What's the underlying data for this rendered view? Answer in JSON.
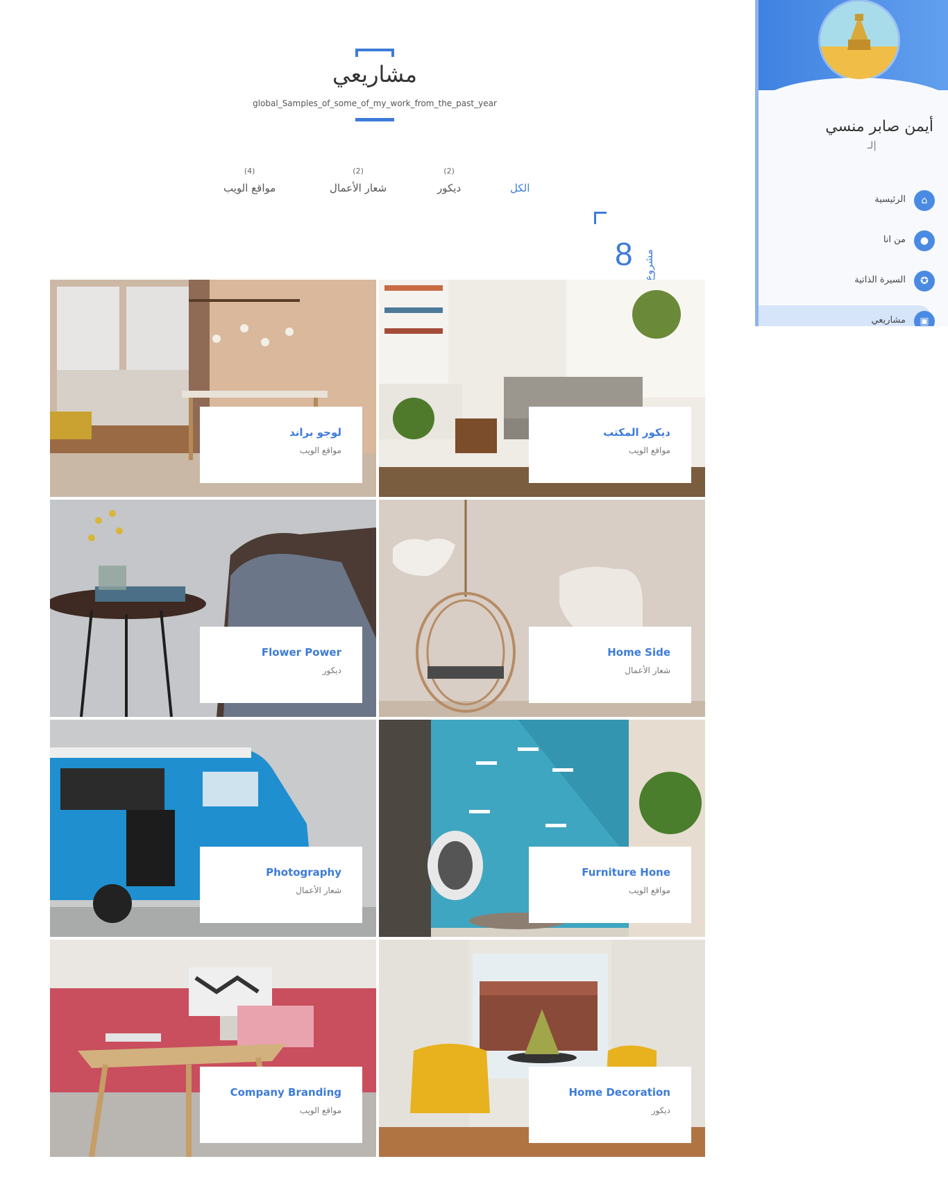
{
  "section": {
    "title": "مشاريعي",
    "subtitle": "global_Samples_of_some_of_my_work_from_the_past_year"
  },
  "filters": [
    {
      "label": "الكل",
      "count": ""
    },
    {
      "label": "ديكور",
      "count": "(2)"
    },
    {
      "label": "شعار الأعمال",
      "count": "(2)"
    },
    {
      "label": "مواقع الويب",
      "count": "(4)"
    }
  ],
  "counter": {
    "number": "8",
    "label": "مشروع"
  },
  "projects": [
    {
      "title": "لوجو براند",
      "category": "مواقع الويب"
    },
    {
      "title": "ديكور المكتب",
      "category": "مواقع الويب"
    },
    {
      "title": "Flower Power",
      "category": "ديكور"
    },
    {
      "title": "Home Side",
      "category": "شعار الأعمال"
    },
    {
      "title": "Photography",
      "category": "شعار الأعمال"
    },
    {
      "title": "Furniture Hone",
      "category": "مواقع الويب"
    },
    {
      "title": "Company Branding",
      "category": "مواقع الويب"
    },
    {
      "title": "Home Decoration",
      "category": "ديكور"
    }
  ],
  "sidebar": {
    "name": "أيمن صابر منسي",
    "typing": "لـ|",
    "nav": [
      {
        "label": "الرئيسية",
        "icon": "home-icon"
      },
      {
        "label": "من انا",
        "icon": "user-icon"
      },
      {
        "label": "السيرة الذاتية",
        "icon": "award-icon"
      },
      {
        "label": "مشاريعي",
        "icon": "briefcase-icon"
      }
    ]
  },
  "colors": {
    "accent": "#3d7bd9",
    "sidebar_top": "#4a8ae2",
    "avatar_sand": "#f0be47"
  }
}
